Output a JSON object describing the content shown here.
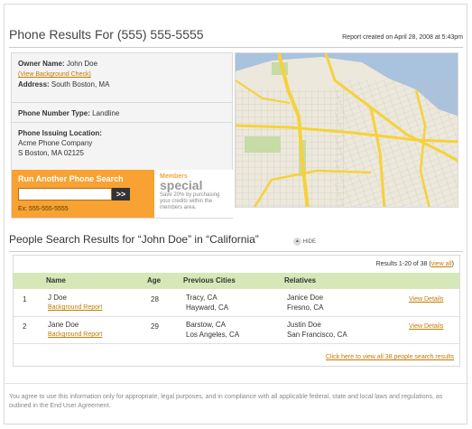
{
  "header": {
    "title": "Phone Results For (555) 555-5555",
    "report_date": "Report created on April 28, 2008 at 5:43pm"
  },
  "owner": {
    "name_label": "Owner Name:",
    "name_value": "John Doe",
    "background_link": "(View Background Check)",
    "address_label": "Address:",
    "address_value": "South Boston, MA"
  },
  "phone_type": {
    "label": "Phone Number Type:",
    "value": "Landline"
  },
  "issuing": {
    "label": "Phone Issuing Location:",
    "company": "Acme Phone Company",
    "location": "S Boston, MA 02125"
  },
  "search": {
    "title": "Run Another Phone Search",
    "input_value": "",
    "button_label": ">>",
    "example": "Ex: 555-555-5555"
  },
  "members": {
    "line1": "Members",
    "line2": "special",
    "line3": "Save 20% by purchasing your credits within the members area."
  },
  "people": {
    "title": "People Search Results for “John Doe” in “California”",
    "hide_label": "HIDE",
    "hide_icon": "▲",
    "count_text": "Results 1-20 of 38 (",
    "count_link": "view all",
    "count_close": ")",
    "columns": [
      "Name",
      "Age",
      "Previous Cities",
      "Relatives"
    ],
    "rows": [
      {
        "num": "1",
        "name": "J Doe",
        "report_link": "Background Report",
        "age": "28",
        "city1": "Tracy, CA",
        "city2": "Hayward, CA",
        "rel1": "Janice Doe",
        "rel2": "Fresno, CA",
        "details": "View Details"
      },
      {
        "num": "2",
        "name": "Jane Doe",
        "report_link": "Background Report",
        "age": "29",
        "city1": "Barstow, CA",
        "city2": "Los Angeles, CA",
        "rel1": "Justin Doe",
        "rel2": "San Francisco, CA",
        "details": "View Details"
      }
    ],
    "view_all": "Click here to view all 38 people search results"
  },
  "disclaimer": "You agree to use this information only for appropriate, legal purposes, and in compliance with all applicable federal, state and local laws and regulations, as outlined in the End User Agreement.",
  "colors": {
    "accent_orange": "#f7a233",
    "link_orange": "#c47a00",
    "table_header_green": "#d6e8b8",
    "map_road_yellow": "#f5d23a"
  }
}
